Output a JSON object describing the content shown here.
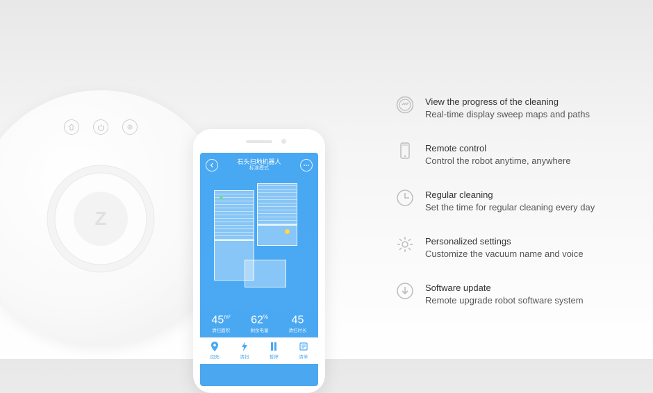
{
  "robot": {
    "center_mark": "Z"
  },
  "phone": {
    "header": {
      "title": "石头扫地机器人",
      "subtitle": "标准模式"
    },
    "stats": [
      {
        "value": "45",
        "unit": "m²",
        "label": "清扫面积"
      },
      {
        "value": "62",
        "unit": "%",
        "label": "剩余电量"
      },
      {
        "value": "45",
        "unit": "",
        "label": "清扫时长"
      }
    ],
    "nav": [
      {
        "label": "回充"
      },
      {
        "label": "清扫"
      },
      {
        "label": "暂停"
      },
      {
        "label": "清单"
      }
    ]
  },
  "features": [
    {
      "icon": "progress-icon",
      "title": "View the progress of the cleaning",
      "desc": "Real-time display sweep maps and paths"
    },
    {
      "icon": "phone-icon",
      "title": "Remote control",
      "desc": "Control  the robot anytime, anywhere"
    },
    {
      "icon": "clock-icon",
      "title": "Regular cleaning",
      "desc": "Set the time for regular cleaning every day"
    },
    {
      "icon": "gear-icon",
      "title": "Personalized settings",
      "desc": "Customize the vacuum name and voice"
    },
    {
      "icon": "download-icon",
      "title": "Software update",
      "desc": "Remote upgrade robot software system"
    }
  ]
}
